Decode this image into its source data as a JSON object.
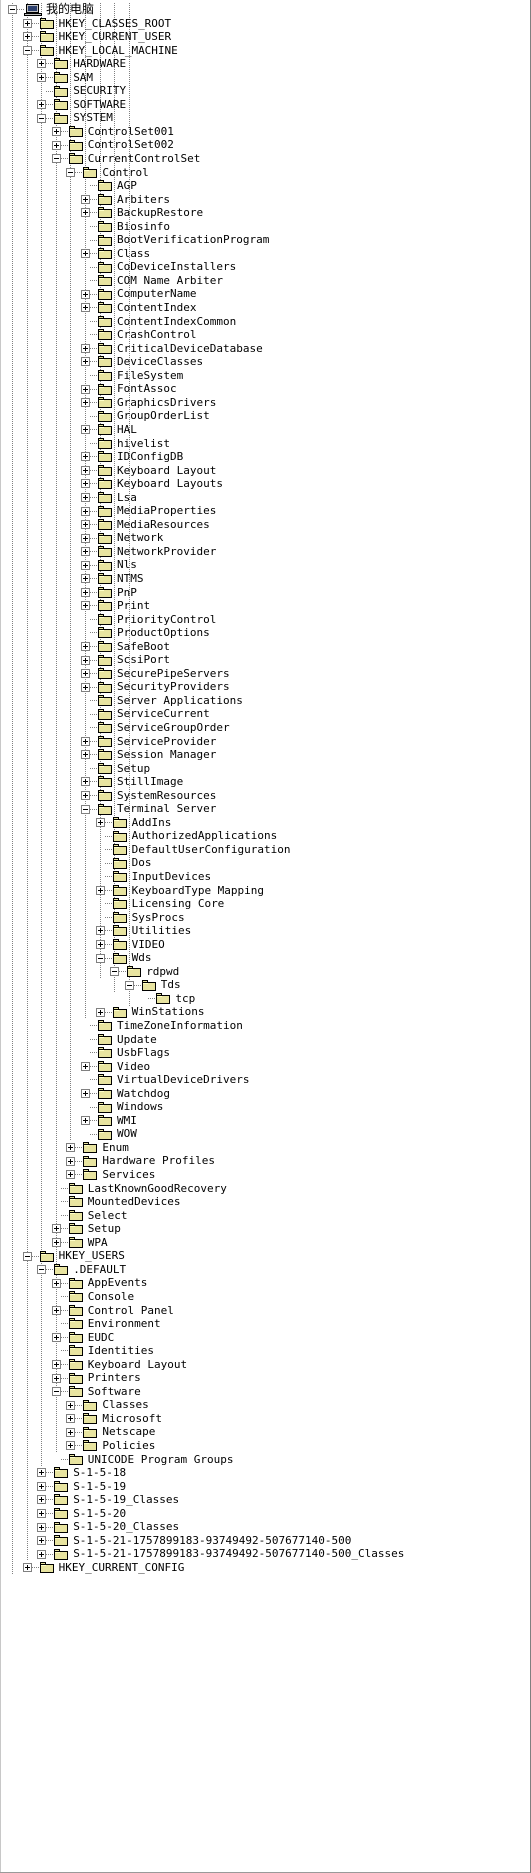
{
  "window": {
    "title": "Registry Editor Tree",
    "colors": {
      "background": "#ffffff",
      "folder_fill": "#e8e4a0",
      "folder_outline": "#000000",
      "guide_line": "#808080",
      "text": "#000000"
    }
  },
  "icons": {
    "computer": "my-computer-icon",
    "folder": "registry-key-folder-icon",
    "expand": "plus-box-icon",
    "collapse": "minus-box-icon"
  },
  "tree": [
    {
      "label": "我的电脑",
      "depth": 0,
      "state": "minus",
      "icon": "computer",
      "cjk": true
    },
    {
      "label": "HKEY_CLASSES_ROOT",
      "depth": 1,
      "state": "plus",
      "icon": "folder"
    },
    {
      "label": "HKEY_CURRENT_USER",
      "depth": 1,
      "state": "plus",
      "icon": "folder"
    },
    {
      "label": "HKEY_LOCAL_MACHINE",
      "depth": 1,
      "state": "minus",
      "icon": "folder"
    },
    {
      "label": "HARDWARE",
      "depth": 2,
      "state": "plus",
      "icon": "folder"
    },
    {
      "label": "SAM",
      "depth": 2,
      "state": "plus",
      "icon": "folder"
    },
    {
      "label": "SECURITY",
      "depth": 2,
      "state": "none",
      "icon": "folder"
    },
    {
      "label": "SOFTWARE",
      "depth": 2,
      "state": "plus",
      "icon": "folder"
    },
    {
      "label": "SYSTEM",
      "depth": 2,
      "state": "minus",
      "icon": "folder"
    },
    {
      "label": "ControlSet001",
      "depth": 3,
      "state": "plus",
      "icon": "folder"
    },
    {
      "label": "ControlSet002",
      "depth": 3,
      "state": "plus",
      "icon": "folder"
    },
    {
      "label": "CurrentControlSet",
      "depth": 3,
      "state": "minus",
      "icon": "folder"
    },
    {
      "label": "Control",
      "depth": 4,
      "state": "minus",
      "icon": "folder"
    },
    {
      "label": "AGP",
      "depth": 5,
      "state": "none",
      "icon": "folder"
    },
    {
      "label": "Arbiters",
      "depth": 5,
      "state": "plus",
      "icon": "folder"
    },
    {
      "label": "BackupRestore",
      "depth": 5,
      "state": "plus",
      "icon": "folder"
    },
    {
      "label": "Biosinfo",
      "depth": 5,
      "state": "none",
      "icon": "folder"
    },
    {
      "label": "BootVerificationProgram",
      "depth": 5,
      "state": "none",
      "icon": "folder"
    },
    {
      "label": "Class",
      "depth": 5,
      "state": "plus",
      "icon": "folder"
    },
    {
      "label": "CoDeviceInstallers",
      "depth": 5,
      "state": "none",
      "icon": "folder"
    },
    {
      "label": "COM Name Arbiter",
      "depth": 5,
      "state": "none",
      "icon": "folder"
    },
    {
      "label": "ComputerName",
      "depth": 5,
      "state": "plus",
      "icon": "folder"
    },
    {
      "label": "ContentIndex",
      "depth": 5,
      "state": "plus",
      "icon": "folder"
    },
    {
      "label": "ContentIndexCommon",
      "depth": 5,
      "state": "none",
      "icon": "folder"
    },
    {
      "label": "CrashControl",
      "depth": 5,
      "state": "none",
      "icon": "folder"
    },
    {
      "label": "CriticalDeviceDatabase",
      "depth": 5,
      "state": "plus",
      "icon": "folder"
    },
    {
      "label": "DeviceClasses",
      "depth": 5,
      "state": "plus",
      "icon": "folder"
    },
    {
      "label": "FileSystem",
      "depth": 5,
      "state": "none",
      "icon": "folder"
    },
    {
      "label": "FontAssoc",
      "depth": 5,
      "state": "plus",
      "icon": "folder"
    },
    {
      "label": "GraphicsDrivers",
      "depth": 5,
      "state": "plus",
      "icon": "folder"
    },
    {
      "label": "GroupOrderList",
      "depth": 5,
      "state": "none",
      "icon": "folder"
    },
    {
      "label": "HAL",
      "depth": 5,
      "state": "plus",
      "icon": "folder"
    },
    {
      "label": "hivelist",
      "depth": 5,
      "state": "none",
      "icon": "folder"
    },
    {
      "label": "IDConfigDB",
      "depth": 5,
      "state": "plus",
      "icon": "folder"
    },
    {
      "label": "Keyboard Layout",
      "depth": 5,
      "state": "plus",
      "icon": "folder"
    },
    {
      "label": "Keyboard Layouts",
      "depth": 5,
      "state": "plus",
      "icon": "folder"
    },
    {
      "label": "Lsa",
      "depth": 5,
      "state": "plus",
      "icon": "folder"
    },
    {
      "label": "MediaProperties",
      "depth": 5,
      "state": "plus",
      "icon": "folder"
    },
    {
      "label": "MediaResources",
      "depth": 5,
      "state": "plus",
      "icon": "folder"
    },
    {
      "label": "Network",
      "depth": 5,
      "state": "plus",
      "icon": "folder"
    },
    {
      "label": "NetworkProvider",
      "depth": 5,
      "state": "plus",
      "icon": "folder"
    },
    {
      "label": "Nls",
      "depth": 5,
      "state": "plus",
      "icon": "folder"
    },
    {
      "label": "NTMS",
      "depth": 5,
      "state": "plus",
      "icon": "folder"
    },
    {
      "label": "PnP",
      "depth": 5,
      "state": "plus",
      "icon": "folder"
    },
    {
      "label": "Print",
      "depth": 5,
      "state": "plus",
      "icon": "folder"
    },
    {
      "label": "PriorityControl",
      "depth": 5,
      "state": "none",
      "icon": "folder"
    },
    {
      "label": "ProductOptions",
      "depth": 5,
      "state": "none",
      "icon": "folder"
    },
    {
      "label": "SafeBoot",
      "depth": 5,
      "state": "plus",
      "icon": "folder"
    },
    {
      "label": "ScsiPort",
      "depth": 5,
      "state": "plus",
      "icon": "folder"
    },
    {
      "label": "SecurePipeServers",
      "depth": 5,
      "state": "plus",
      "icon": "folder"
    },
    {
      "label": "SecurityProviders",
      "depth": 5,
      "state": "plus",
      "icon": "folder"
    },
    {
      "label": "Server Applications",
      "depth": 5,
      "state": "none",
      "icon": "folder"
    },
    {
      "label": "ServiceCurrent",
      "depth": 5,
      "state": "none",
      "icon": "folder"
    },
    {
      "label": "ServiceGroupOrder",
      "depth": 5,
      "state": "none",
      "icon": "folder"
    },
    {
      "label": "ServiceProvider",
      "depth": 5,
      "state": "plus",
      "icon": "folder"
    },
    {
      "label": "Session Manager",
      "depth": 5,
      "state": "plus",
      "icon": "folder"
    },
    {
      "label": "Setup",
      "depth": 5,
      "state": "none",
      "icon": "folder"
    },
    {
      "label": "StillImage",
      "depth": 5,
      "state": "plus",
      "icon": "folder"
    },
    {
      "label": "SystemResources",
      "depth": 5,
      "state": "plus",
      "icon": "folder"
    },
    {
      "label": "Terminal Server",
      "depth": 5,
      "state": "minus",
      "icon": "folder"
    },
    {
      "label": "AddIns",
      "depth": 6,
      "state": "plus",
      "icon": "folder"
    },
    {
      "label": "AuthorizedApplications",
      "depth": 6,
      "state": "none",
      "icon": "folder"
    },
    {
      "label": "DefaultUserConfiguration",
      "depth": 6,
      "state": "none",
      "icon": "folder"
    },
    {
      "label": "Dos",
      "depth": 6,
      "state": "none",
      "icon": "folder"
    },
    {
      "label": "InputDevices",
      "depth": 6,
      "state": "none",
      "icon": "folder"
    },
    {
      "label": "KeyboardType Mapping",
      "depth": 6,
      "state": "plus",
      "icon": "folder"
    },
    {
      "label": "Licensing Core",
      "depth": 6,
      "state": "none",
      "icon": "folder"
    },
    {
      "label": "SysProcs",
      "depth": 6,
      "state": "none",
      "icon": "folder"
    },
    {
      "label": "Utilities",
      "depth": 6,
      "state": "plus",
      "icon": "folder"
    },
    {
      "label": "VIDEO",
      "depth": 6,
      "state": "plus",
      "icon": "folder"
    },
    {
      "label": "Wds",
      "depth": 6,
      "state": "minus",
      "icon": "folder"
    },
    {
      "label": "rdpwd",
      "depth": 7,
      "state": "minus",
      "icon": "folder"
    },
    {
      "label": "Tds",
      "depth": 8,
      "state": "minus",
      "icon": "folder"
    },
    {
      "label": "tcp",
      "depth": 9,
      "state": "none",
      "icon": "folder"
    },
    {
      "label": "WinStations",
      "depth": 6,
      "state": "plus",
      "icon": "folder"
    },
    {
      "label": "TimeZoneInformation",
      "depth": 5,
      "state": "none",
      "icon": "folder"
    },
    {
      "label": "Update",
      "depth": 5,
      "state": "none",
      "icon": "folder"
    },
    {
      "label": "UsbFlags",
      "depth": 5,
      "state": "none",
      "icon": "folder"
    },
    {
      "label": "Video",
      "depth": 5,
      "state": "plus",
      "icon": "folder"
    },
    {
      "label": "VirtualDeviceDrivers",
      "depth": 5,
      "state": "none",
      "icon": "folder"
    },
    {
      "label": "Watchdog",
      "depth": 5,
      "state": "plus",
      "icon": "folder"
    },
    {
      "label": "Windows",
      "depth": 5,
      "state": "none",
      "icon": "folder"
    },
    {
      "label": "WMI",
      "depth": 5,
      "state": "plus",
      "icon": "folder"
    },
    {
      "label": "WOW",
      "depth": 5,
      "state": "none",
      "icon": "folder"
    },
    {
      "label": "Enum",
      "depth": 4,
      "state": "plus",
      "icon": "folder"
    },
    {
      "label": "Hardware Profiles",
      "depth": 4,
      "state": "plus",
      "icon": "folder"
    },
    {
      "label": "Services",
      "depth": 4,
      "state": "plus",
      "icon": "folder"
    },
    {
      "label": "LastKnownGoodRecovery",
      "depth": 3,
      "state": "none",
      "icon": "folder"
    },
    {
      "label": "MountedDevices",
      "depth": 3,
      "state": "none",
      "icon": "folder"
    },
    {
      "label": "Select",
      "depth": 3,
      "state": "none",
      "icon": "folder"
    },
    {
      "label": "Setup",
      "depth": 3,
      "state": "plus",
      "icon": "folder"
    },
    {
      "label": "WPA",
      "depth": 3,
      "state": "plus",
      "icon": "folder"
    },
    {
      "label": "HKEY_USERS",
      "depth": 1,
      "state": "minus",
      "icon": "folder"
    },
    {
      "label": ".DEFAULT",
      "depth": 2,
      "state": "minus",
      "icon": "folder"
    },
    {
      "label": "AppEvents",
      "depth": 3,
      "state": "plus",
      "icon": "folder"
    },
    {
      "label": "Console",
      "depth": 3,
      "state": "none",
      "icon": "folder"
    },
    {
      "label": "Control Panel",
      "depth": 3,
      "state": "plus",
      "icon": "folder"
    },
    {
      "label": "Environment",
      "depth": 3,
      "state": "none",
      "icon": "folder"
    },
    {
      "label": "EUDC",
      "depth": 3,
      "state": "plus",
      "icon": "folder"
    },
    {
      "label": "Identities",
      "depth": 3,
      "state": "none",
      "icon": "folder"
    },
    {
      "label": "Keyboard Layout",
      "depth": 3,
      "state": "plus",
      "icon": "folder"
    },
    {
      "label": "Printers",
      "depth": 3,
      "state": "plus",
      "icon": "folder"
    },
    {
      "label": "Software",
      "depth": 3,
      "state": "minus",
      "icon": "folder"
    },
    {
      "label": "Classes",
      "depth": 4,
      "state": "plus",
      "icon": "folder"
    },
    {
      "label": "Microsoft",
      "depth": 4,
      "state": "plus",
      "icon": "folder"
    },
    {
      "label": "Netscape",
      "depth": 4,
      "state": "plus",
      "icon": "folder"
    },
    {
      "label": "Policies",
      "depth": 4,
      "state": "plus",
      "icon": "folder"
    },
    {
      "label": "UNICODE Program Groups",
      "depth": 3,
      "state": "none",
      "icon": "folder"
    },
    {
      "label": "S-1-5-18",
      "depth": 2,
      "state": "plus",
      "icon": "folder"
    },
    {
      "label": "S-1-5-19",
      "depth": 2,
      "state": "plus",
      "icon": "folder"
    },
    {
      "label": "S-1-5-19_Classes",
      "depth": 2,
      "state": "plus",
      "icon": "folder"
    },
    {
      "label": "S-1-5-20",
      "depth": 2,
      "state": "plus",
      "icon": "folder"
    },
    {
      "label": "S-1-5-20_Classes",
      "depth": 2,
      "state": "plus",
      "icon": "folder"
    },
    {
      "label": "S-1-5-21-1757899183-93749492-507677140-500",
      "depth": 2,
      "state": "plus",
      "icon": "folder"
    },
    {
      "label": "S-1-5-21-1757899183-93749492-507677140-500_Classes",
      "depth": 2,
      "state": "plus",
      "icon": "folder"
    },
    {
      "label": "HKEY_CURRENT_CONFIG",
      "depth": 1,
      "state": "plus",
      "icon": "folder"
    }
  ]
}
